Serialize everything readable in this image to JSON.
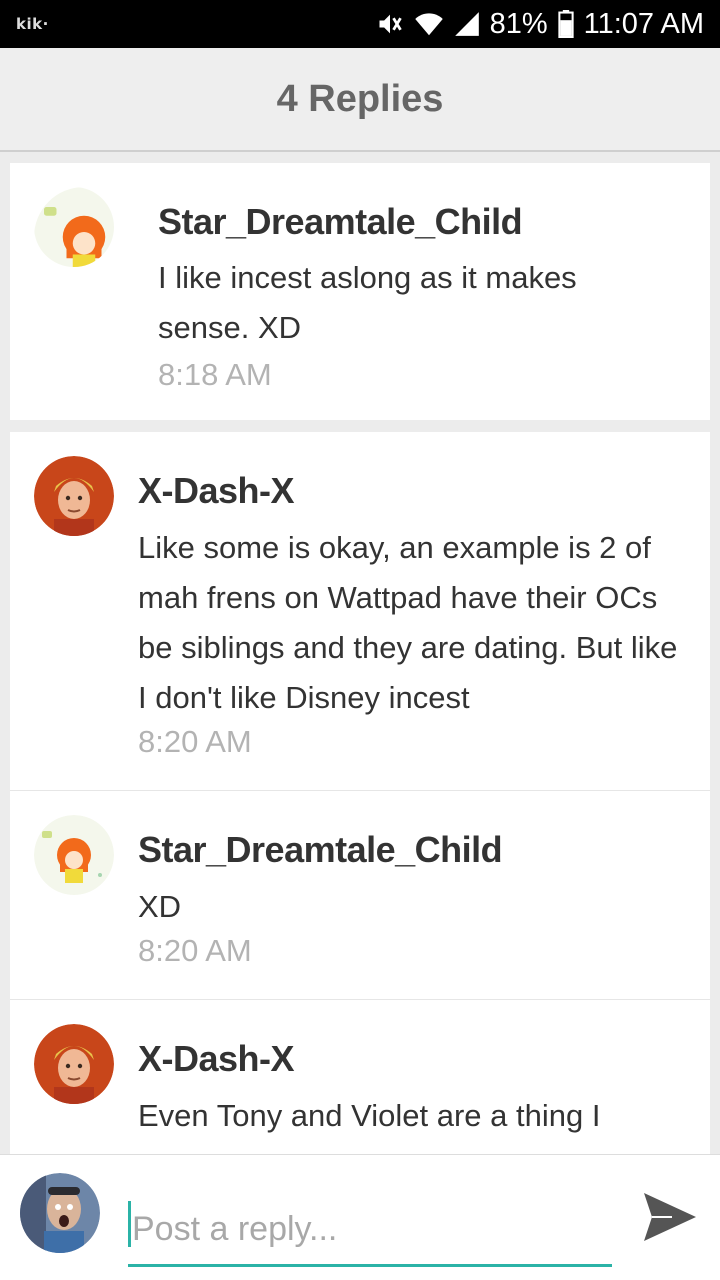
{
  "status_bar": {
    "app": "kik·",
    "battery": "81%",
    "time": "11:07 AM"
  },
  "header": {
    "title": "4 Replies"
  },
  "replies": [
    {
      "author": "Star_Dreamtale_Child",
      "text": "I like incest aslong as it makes sense. XD",
      "time": "8:18 AM"
    },
    {
      "author": "X-Dash-X",
      "text": "Like some is okay, an example is 2 of mah frens on Wattpad have their OCs be siblings and they are dating. But like I don't like Disney incest",
      "time": "8:20 AM"
    },
    {
      "author": "Star_Dreamtale_Child",
      "text": "XD",
      "time": "8:20 AM"
    },
    {
      "author": "X-Dash-X",
      "text": "Even Tony and Violet are a thing I",
      "time": ""
    }
  ],
  "composer": {
    "placeholder": "Post a reply..."
  },
  "icons": {
    "mute": "mute-icon",
    "wifi": "wifi-icon",
    "signal": "signal-icon",
    "battery": "battery-icon",
    "send": "send-icon"
  },
  "colors": {
    "accent": "#2bb3a7",
    "status_bar": "#000000",
    "header_bg": "#eeeeee",
    "timestamp": "#b3b3b3"
  }
}
